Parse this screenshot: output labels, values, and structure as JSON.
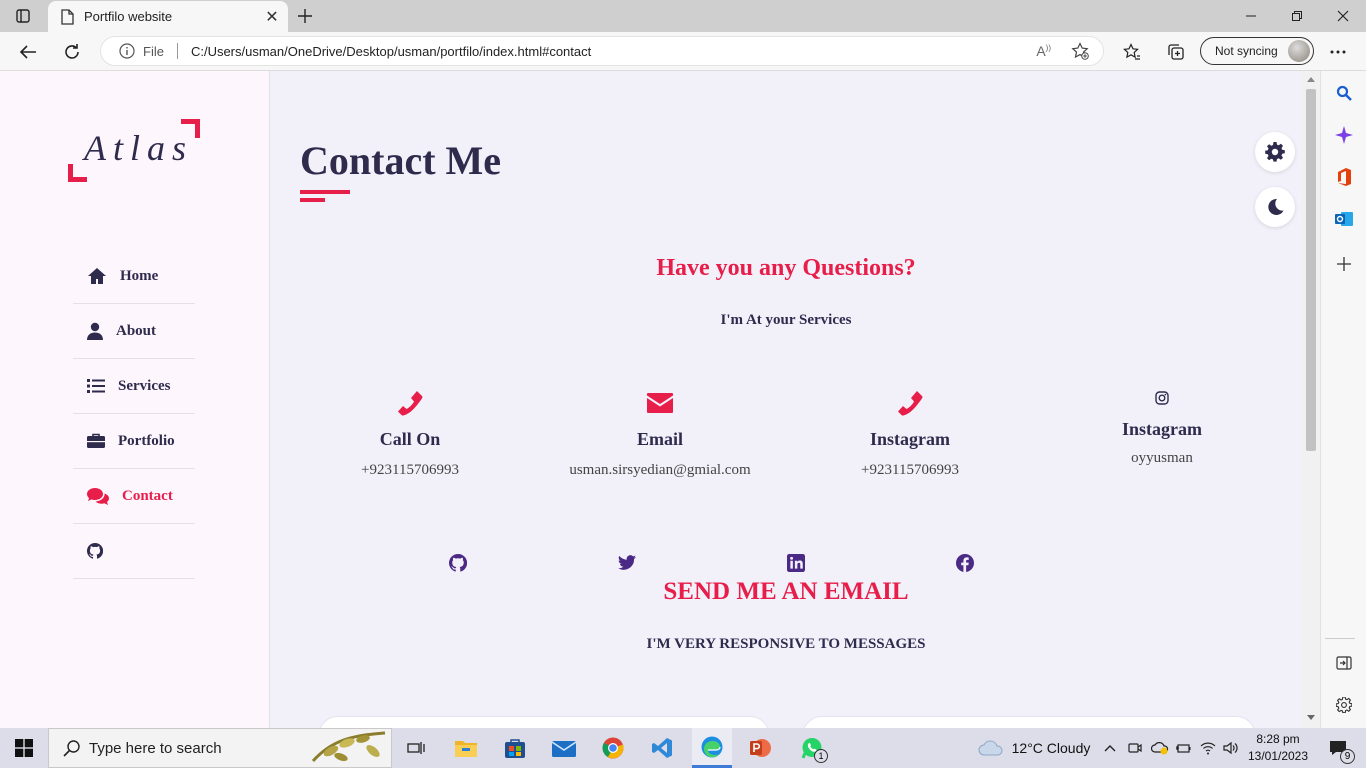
{
  "browser": {
    "tab_title": "Portfilo website",
    "file_label": "File",
    "url": "C:/Users/usman/OneDrive/Desktop/usman/portfilo/index.html#contact",
    "sync_label": "Not syncing"
  },
  "sidebar": {
    "logo": "Atlas",
    "items": [
      {
        "label": "Home",
        "icon": "home-icon"
      },
      {
        "label": "About",
        "icon": "user-icon"
      },
      {
        "label": "Services",
        "icon": "list-icon"
      },
      {
        "label": "Portfolio",
        "icon": "briefcase-icon"
      },
      {
        "label": "Contact",
        "icon": "comments-icon",
        "active": true
      },
      {
        "label": "",
        "icon": "github-icon"
      }
    ]
  },
  "main": {
    "title": "Contact Me",
    "question": "Have you any Questions?",
    "question_sub": "I'm At your Services",
    "cards": [
      {
        "title": "Call On",
        "value": "+923115706993",
        "icon": "phone-icon"
      },
      {
        "title": "Email",
        "value": "usman.sirsyedian@gmial.com",
        "icon": "envelope-icon"
      },
      {
        "title": "Instagram",
        "value": "+923115706993",
        "icon": "phone-icon"
      },
      {
        "title": "Instagram",
        "value": "oyyusman",
        "icon": "instagram-icon"
      }
    ],
    "socials": [
      "github-icon",
      "twitter-icon",
      "linkedin-icon",
      "facebook-icon"
    ],
    "send_title": "SEND ME AN EMAIL",
    "send_sub": "I'M VERY RESPONSIVE TO MESSAGES"
  },
  "taskbar": {
    "search_placeholder": "Type here to search",
    "weather": "12°C  Cloudy",
    "time": "8:28 pm",
    "date": "13/01/2023",
    "notification_count": "9",
    "whatsapp_badge": "1"
  },
  "colors": {
    "accent": "#e81e4a",
    "heading": "#2f2b4d",
    "social": "#4b2a86",
    "page_bg": "#f2f1fa",
    "sidebar_bg": "#fdf6fd"
  }
}
